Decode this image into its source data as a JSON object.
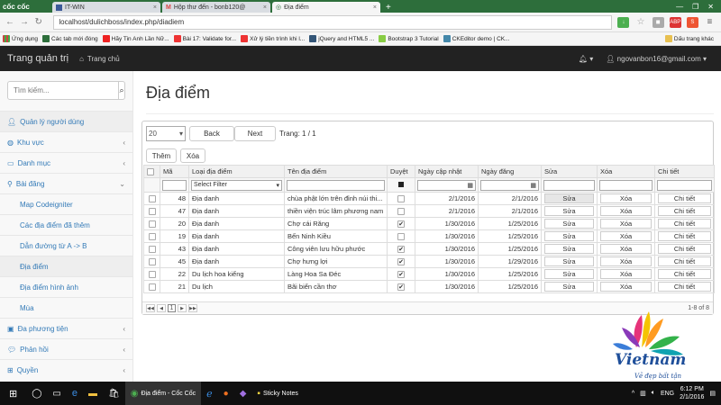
{
  "browser": {
    "logo": "cốc cốc",
    "tabs": [
      "IT-WIN",
      "Hộp thư đến - bonb120@",
      "Địa điểm"
    ],
    "url": "localhost/dulichboss/index.php/diadiem",
    "bookmarks": [
      "Ứng dụng",
      "Các tab mới đóng",
      "Hãy Tin Anh Lần Nữ...",
      "Bài 17: Validate for...",
      "Xử lý tiền trình khi l...",
      "jQuery and HTML5 ...",
      "Bootstrap 3 Tutorial",
      "CKEditor demo | CK..."
    ],
    "bookmark_right": "Dấu trang khác"
  },
  "nav": {
    "brand": "Trang quản trị",
    "home": "Trang chủ",
    "user": "ngovanbon16@gmail.com"
  },
  "sidebar": {
    "search_placeholder": "Tìm kiếm...",
    "items": [
      {
        "label": "Quản lý người dùng",
        "icon": "user-icon"
      },
      {
        "label": "Khu vực",
        "icon": "globe-icon"
      },
      {
        "label": "Danh mục",
        "icon": "folder-icon"
      },
      {
        "label": "Bài đăng",
        "icon": "marker-icon"
      }
    ],
    "subitems": [
      "Map Codeigniter",
      "Các địa điểm đã thêm",
      "Dẫn đường từ A -> B",
      "Địa điểm",
      "Địa điểm hình ảnh",
      "Mùa"
    ],
    "items2": [
      {
        "label": "Đa phương tiện",
        "icon": "media-icon"
      },
      {
        "label": "Phản hồi",
        "icon": "chat-icon"
      },
      {
        "label": "Quyền",
        "icon": "sitemap-icon"
      }
    ]
  },
  "page": {
    "title": "Địa điểm",
    "page_size": "20",
    "back": "Back",
    "next": "Next",
    "page_label": "Trang: 1 / 1",
    "add": "Thêm",
    "delete": "Xóa",
    "headers": [
      "",
      "Mã",
      "Loại địa điểm",
      "Tên địa điểm",
      "Duyệt",
      "Ngày cập nhật",
      "Ngày đăng",
      "Sửa",
      "Xóa",
      "Chi tiết"
    ],
    "filter_select": "Select Filter",
    "edit_label": "Sửa",
    "delete_label": "Xóa",
    "detail_label": "Chi tiết",
    "rows": [
      {
        "id": "48",
        "type": "Địa danh",
        "name": "chùa phật lớn trên đỉnh núi thi...",
        "approved": false,
        "updated": "2/1/2016",
        "posted": "2/1/2016"
      },
      {
        "id": "47",
        "type": "Địa danh",
        "name": "thiền viện trúc lâm phương nam",
        "approved": false,
        "updated": "2/1/2016",
        "posted": "2/1/2016"
      },
      {
        "id": "20",
        "type": "Địa danh",
        "name": "Chợ cái Răng",
        "approved": true,
        "updated": "1/30/2016",
        "posted": "1/25/2016"
      },
      {
        "id": "19",
        "type": "Địa danh",
        "name": "Bến Ninh Kiều",
        "approved": false,
        "updated": "1/30/2016",
        "posted": "1/25/2016"
      },
      {
        "id": "43",
        "type": "Địa danh",
        "name": "Công viên lưu hữu phước",
        "approved": true,
        "updated": "1/30/2016",
        "posted": "1/25/2016"
      },
      {
        "id": "45",
        "type": "Địa danh",
        "name": "Chợ hưng lợi",
        "approved": true,
        "updated": "1/30/2016",
        "posted": "1/29/2016"
      },
      {
        "id": "22",
        "type": "Du lịch hoa kiểng",
        "name": "Làng Hoa Sa Đéc",
        "approved": true,
        "updated": "1/30/2016",
        "posted": "1/25/2016"
      },
      {
        "id": "21",
        "type": "Du lịch",
        "name": "Bãi biển cần thơ",
        "approved": true,
        "updated": "1/30/2016",
        "posted": "1/25/2016"
      }
    ],
    "pager_current": "1",
    "pager_info": "1-8 of 8"
  },
  "logo": {
    "name": "Vietnam",
    "slogan": "Vẻ đẹp bất tận"
  },
  "taskbar": {
    "items": [
      "Địa điểm - Cốc Cốc",
      "Sticky Notes"
    ],
    "lang": "ENG",
    "time": "6:12 PM",
    "date": "2/1/2016"
  }
}
